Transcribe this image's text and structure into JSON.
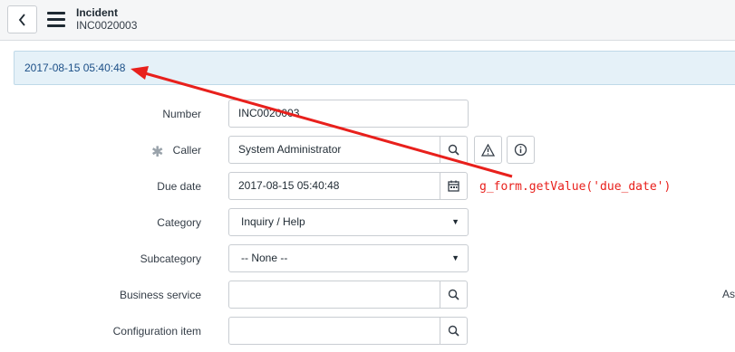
{
  "header": {
    "title": "Incident",
    "record_number": "INC0020003"
  },
  "info_message": "2017-08-15 05:40:48",
  "form": {
    "number": {
      "label": "Number",
      "value": "INC0020003"
    },
    "caller": {
      "label": "Caller",
      "value": "System Administrator"
    },
    "due_date": {
      "label": "Due date",
      "value": "2017-08-15 05:40:48"
    },
    "category": {
      "label": "Category",
      "value": "Inquiry / Help"
    },
    "subcategory": {
      "label": "Subcategory",
      "value": "-- None --"
    },
    "business_service": {
      "label": "Business service",
      "value": ""
    },
    "configuration_item": {
      "label": "Configuration item",
      "value": ""
    },
    "right_column_label": "Ass"
  },
  "annotation": {
    "text": "g_form.getValue('due_date')",
    "color": "#e8201c"
  },
  "icons": {
    "back": "chevron-left-icon",
    "menu": "hamburger-menu-icon",
    "search": "magnifier-icon",
    "warning": "warning-triangle-icon",
    "info": "info-circle-icon",
    "calendar": "calendar-icon",
    "dropdown": "caret-down-icon"
  }
}
